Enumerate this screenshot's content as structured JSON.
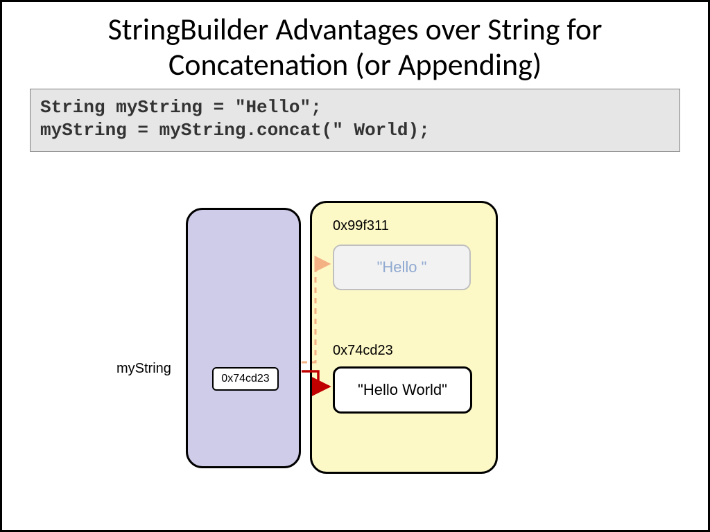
{
  "title": "StringBuilder Advantages over String for Concatenation (or Appending)",
  "code": "String myString = \"Hello\";\nmyString = myString.concat(\" World);",
  "variable": {
    "name": "myString",
    "value": "0x74cd23"
  },
  "heap": {
    "addr1": "0x99f311",
    "obj1": "\"Hello \"",
    "addr2": "0x74cd23",
    "obj2": "\"Hello World\""
  },
  "colors": {
    "stack_fill": "#cfccea",
    "heap_fill": "#fdf9c7",
    "code_bg": "#e6e6e6",
    "faded_text": "#8fa9d1",
    "faded_border": "#bfbfbf",
    "arrow_old": "#f4b183",
    "arrow_new": "#c00000"
  }
}
